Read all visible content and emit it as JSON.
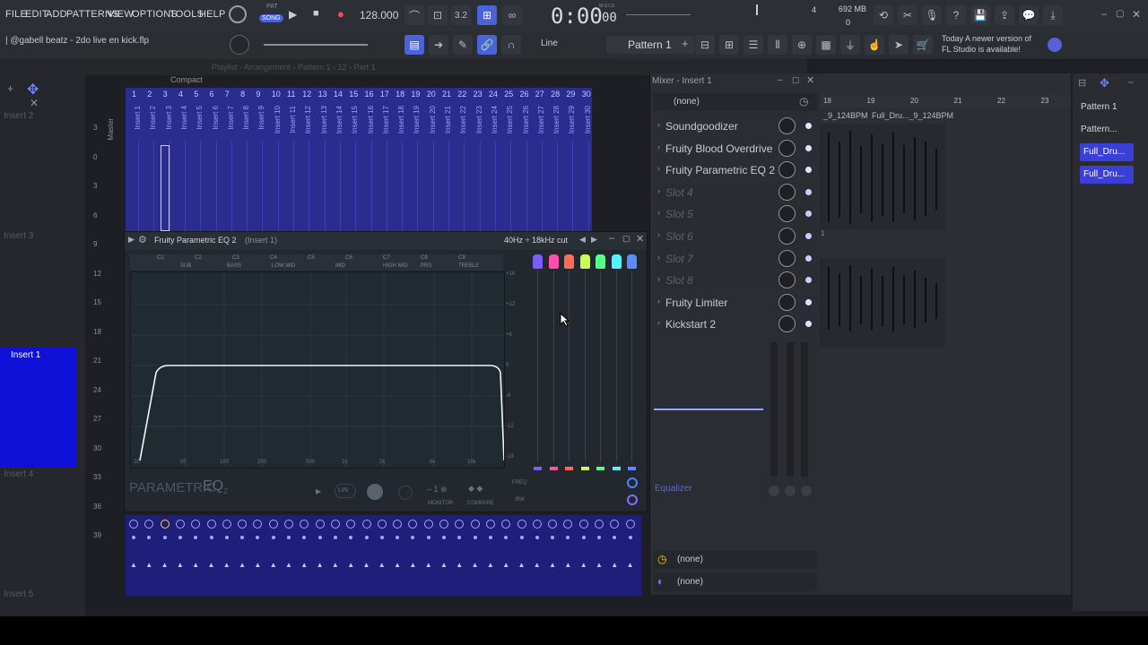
{
  "menu": [
    "FILE",
    "EDIT",
    "ADD",
    "PATTERNS",
    "VIEW",
    "OPTIONS",
    "TOOLS",
    "HELP"
  ],
  "transport": {
    "pat_label": "PAT",
    "song_label": "SONG",
    "tempo": "128.000",
    "time": "0:00",
    "time_small": "00",
    "time_unit": "M:S:CS",
    "memory": "692 MB",
    "cpu_count": "0",
    "voices": "4"
  },
  "hint": {
    "text": "|  @gabell beatz - 2do live en kick.flp",
    "snap": "Line",
    "pattern": "Pattern 1",
    "news_line1": "Today  A newer version of",
    "news_line2": "FL Studio is available!"
  },
  "playlist_header": {
    "title": "Playlist - Arrangement › Pattern 1 › 12 › Part 1",
    "compact": "Compact"
  },
  "mixer_tracks": [
    "1",
    "2",
    "3",
    "4",
    "5",
    "6",
    "7",
    "8",
    "9",
    "10",
    "11",
    "12",
    "13",
    "14",
    "15",
    "16",
    "17",
    "18",
    "19",
    "20",
    "21",
    "22",
    "23",
    "24",
    "25",
    "26",
    "27",
    "28",
    "29",
    "30"
  ],
  "mixer_names": [
    "Insert 1",
    "Insert 2",
    "Insert 3",
    "Insert 4",
    "Insert 5",
    "Insert 6",
    "Insert 7",
    "Insert 8",
    "Insert 9",
    "Insert 10",
    "Insert 11",
    "Insert 12",
    "Insert 13",
    "Insert 14",
    "Insert 15",
    "Insert 16",
    "Insert 17",
    "Insert 18",
    "Insert 19",
    "Insert 20",
    "Insert 21",
    "Insert 22",
    "Insert 23",
    "Insert 24",
    "Insert 25",
    "Insert 26",
    "Insert 27",
    "Insert 28",
    "Insert 29",
    "Insert 30"
  ],
  "master_label": "Master",
  "left_inserts": {
    "i2": "Insert 2",
    "i3": "Insert 3",
    "i1": "Insert 1",
    "i4": "Insert 4",
    "i5": "Insert 5"
  },
  "db_scale": [
    "3",
    "0",
    "3",
    "6",
    "9",
    "12",
    "15",
    "18",
    "21",
    "24",
    "27",
    "30",
    "33",
    "36",
    "39"
  ],
  "eq": {
    "title": "Fruity Parametric EQ 2",
    "title_sub": "(Insert 1)",
    "range": "40Hz ÷ 18kHz cut",
    "bands": [
      "C1",
      "C2",
      "C3",
      "C4",
      "C5",
      "C6",
      "C7",
      "C8",
      "C9"
    ],
    "band_names": [
      "SUB",
      "BASS",
      "LOW MID",
      "MID",
      "HIGH MID",
      "PRS",
      "TREBLE"
    ],
    "freq_ticks": [
      "20",
      "50",
      "100",
      "200",
      "500",
      "1k",
      "2k",
      "5k",
      "10k"
    ],
    "db_ticks": [
      "+18",
      "+12",
      "+6",
      "0",
      "-6",
      "-12",
      "-18"
    ],
    "brand": "PARAMETRIC",
    "brand_eq": "EQ",
    "brand_num": "2",
    "lin": "LIN",
    "monitor": "MONITOR",
    "compare": "COMPARE",
    "freq": "FREQ",
    "bw": "BW",
    "band_colors": [
      "#7b5cff",
      "#ff4fa8",
      "#ff6a5a",
      "#c8ff57",
      "#57ff8a",
      "#57f0ff",
      "#5a8cff"
    ]
  },
  "mixer": {
    "title": "Mixer - Insert 1",
    "input": "(none)",
    "slots": [
      {
        "label": "Soundgoodizer",
        "on": true
      },
      {
        "label": "Fruity Blood Overdrive",
        "on": true
      },
      {
        "label": "Fruity Parametric EQ 2",
        "on": true
      },
      {
        "label": "Slot 4",
        "on": false
      },
      {
        "label": "Slot 5",
        "on": false
      },
      {
        "label": "Slot 6",
        "on": false
      },
      {
        "label": "Slot 7",
        "on": false
      },
      {
        "label": "Slot 8",
        "on": false
      },
      {
        "label": "Fruity Limiter",
        "on": true
      },
      {
        "label": "Kickstart 2",
        "on": true
      }
    ],
    "equalizer": "Equalizer",
    "out1": "(none)",
    "out2": "(none)"
  },
  "timeline": [
    "18",
    "19",
    "20",
    "21",
    "22",
    "23"
  ],
  "clips": {
    "c1": "_9_124BPM",
    "c2": "Full_Dru..._9_124BPM",
    "c3": "1"
  },
  "patterns": [
    "Pattern 1",
    "Pattern..."
  ],
  "pattern_clips": [
    "Full_Dru...",
    "Full_Dru..."
  ]
}
